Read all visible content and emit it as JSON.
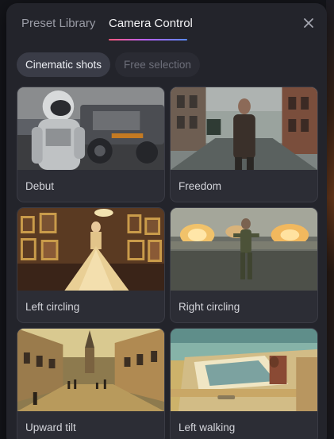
{
  "tabs": [
    {
      "label": "Preset Library",
      "active": false
    },
    {
      "label": "Camera Control",
      "active": true
    }
  ],
  "close_icon": "close-icon",
  "chips": [
    {
      "label": "Cinematic shots",
      "selected": true
    },
    {
      "label": "Free selection",
      "selected": false
    }
  ],
  "presets": [
    {
      "label": "Debut",
      "thumbnail": "astronaut-by-rover"
    },
    {
      "label": "Freedom",
      "thumbnail": "man-walking-in-rainy-street"
    },
    {
      "label": "Left circling",
      "thumbnail": "ballgown-in-gallery"
    },
    {
      "label": "Right circling",
      "thumbnail": "soldier-in-battlefield"
    },
    {
      "label": "Upward tilt",
      "thumbnail": "old-town-street"
    },
    {
      "label": "Left walking",
      "thumbnail": "vintage-car-desert"
    }
  ],
  "colors": {
    "panel": "#23242b",
    "card": "#2c2d35",
    "accent_gradient": [
      "#ff5a7a",
      "#b362ff",
      "#5a8cff"
    ]
  }
}
